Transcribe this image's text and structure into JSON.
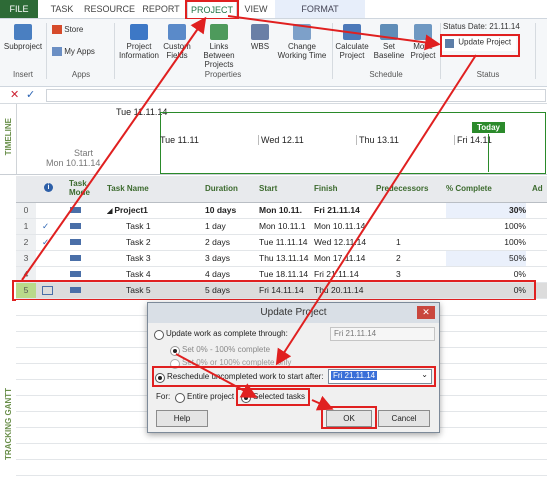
{
  "tabs": [
    "FILE",
    "TASK",
    "RESOURCE",
    "REPORT",
    "PROJECT",
    "VIEW",
    "FORMAT"
  ],
  "ribbon": {
    "subproject": "Subproject",
    "store": "Store",
    "my_apps": "My Apps",
    "project_information": "Project Information",
    "custom_fields": "Custom Fields",
    "links_between_projects": "Links Between Projects",
    "wbs": "WBS",
    "change_working_time": "Change Working Time",
    "calculate_project": "Calculate Project",
    "set_baseline": "Set Baseline",
    "move_project": "Move Project",
    "status_date_label": "Status Date:",
    "status_date_value": "21.11.14",
    "update_project": "Update Project",
    "groups": {
      "insert": "Insert",
      "apps": "Apps",
      "properties": "Properties",
      "schedule": "Schedule",
      "status": "Status"
    }
  },
  "timeline": {
    "label": "TIMELINE",
    "top_date": "Tue 11.11.14",
    "start_label": "Start",
    "start_date": "Mon 10.11.14",
    "ticks": [
      "Tue 11.11",
      "Wed 12.11",
      "Thu 13.11",
      "Fri 14.11"
    ],
    "today": "Today"
  },
  "view_label": "TRACKING GANTT",
  "table": {
    "headers": [
      "Task Mode",
      "Task Name",
      "Duration",
      "Start",
      "Finish",
      "Predecessors",
      "% Complete",
      "Ad"
    ],
    "rows": [
      {
        "id": "0",
        "name": "Project1",
        "duration": "10 days",
        "start": "Mon 10.11.",
        "finish": "Fri 21.11.14",
        "pred": "",
        "pct": "30%"
      },
      {
        "id": "1",
        "name": "Task 1",
        "duration": "1 day",
        "start": "Mon 10.11.1",
        "finish": "Mon 10.11.14",
        "pred": "",
        "pct": "100%"
      },
      {
        "id": "2",
        "name": "Task 2",
        "duration": "2 days",
        "start": "Tue 11.11.14",
        "finish": "Wed 12.11.14",
        "pred": "1",
        "pct": "100%"
      },
      {
        "id": "3",
        "name": "Task 3",
        "duration": "3 days",
        "start": "Thu 13.11.14",
        "finish": "Mon 17.11.14",
        "pred": "2",
        "pct": "50%"
      },
      {
        "id": "4",
        "name": "Task 4",
        "duration": "4 days",
        "start": "Tue 18.11.14",
        "finish": "Fri 21.11.14",
        "pred": "3",
        "pct": "0%"
      },
      {
        "id": "5",
        "name": "Task 5",
        "duration": "5 days",
        "start": "Fri 14.11.14",
        "finish": "Thu 20.11.14",
        "pred": "",
        "pct": "0%"
      }
    ]
  },
  "dialog": {
    "title": "Update Project",
    "opt_update_work": "Update work as complete through:",
    "update_date": "Fri 21.11.14",
    "opt_0_100": "Set 0% - 100% complete",
    "opt_0_or_100": "Set 0% or 100% complete only",
    "opt_reschedule": "Reschedule uncompleted work to start after:",
    "reschedule_date": "Fri 21.11.14",
    "for_label": "For:",
    "entire_project": "Entire project",
    "selected_tasks": "Selected tasks",
    "help": "Help",
    "ok": "OK",
    "cancel": "Cancel"
  },
  "colors": {
    "accent_green": "#217346",
    "annotation_red": "#e02020",
    "selection_blue": "#3a6fd8"
  }
}
